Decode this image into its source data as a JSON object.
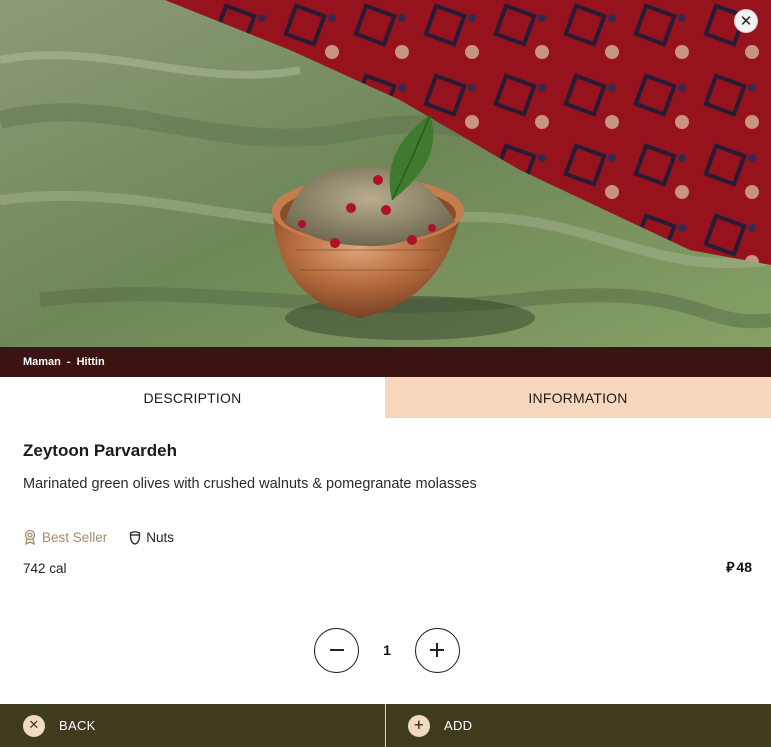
{
  "hero": {
    "image_alt": "Zeytoon Parvardeh dish photo",
    "close_icon": "close-icon"
  },
  "breadcrumb": {
    "restaurant": "Maman",
    "separator": "-",
    "branch": "Hittin"
  },
  "tabs": [
    {
      "label": "DESCRIPTION",
      "active": true
    },
    {
      "label": "INFORMATION",
      "active": false
    }
  ],
  "item": {
    "name": "Zeytoon Parvardeh",
    "description": "Marinated green olives with crushed walnuts & pomegranate molasses",
    "tags": [
      {
        "label": "Best Seller",
        "icon": "award-icon",
        "color": "#a98b6c"
      },
      {
        "label": "Nuts",
        "icon": "nut-icon",
        "color": "#222222"
      }
    ],
    "calories": "742 cal",
    "currency_symbol": "⃁",
    "price": "48"
  },
  "quantity": {
    "value": "1",
    "decrement_icon": "minus-icon",
    "increment_icon": "plus-icon"
  },
  "footer": {
    "back_label": "BACK",
    "add_label": "ADD",
    "back_icon": "close-icon",
    "add_icon": "plus-icon"
  },
  "colors": {
    "crumb_bg": "#3c1212",
    "info_tab_bg": "#f6d6bd",
    "footer_bg": "#3e3b1e",
    "accent_circle": "#f3d9c1"
  }
}
